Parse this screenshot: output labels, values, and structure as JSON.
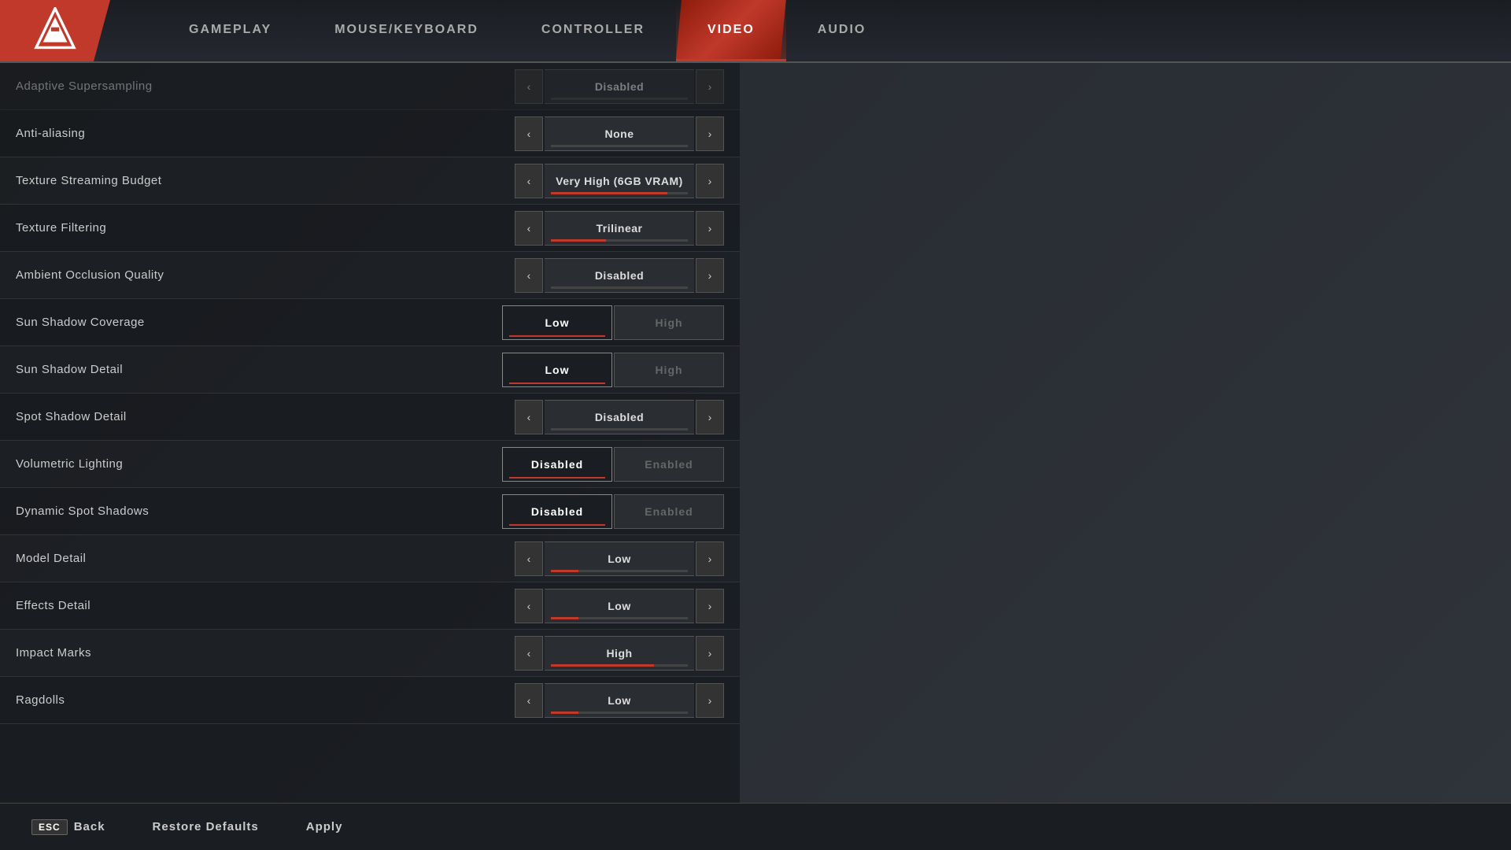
{
  "nav": {
    "tabs": [
      {
        "id": "gameplay",
        "label": "GAMEPLAY",
        "active": false
      },
      {
        "id": "mouse-keyboard",
        "label": "MOUSE/KEYBOARD",
        "active": false
      },
      {
        "id": "controller",
        "label": "CONTROLLER",
        "active": false
      },
      {
        "id": "video",
        "label": "VIDEO",
        "active": true
      },
      {
        "id": "audio",
        "label": "AUDIO",
        "active": false
      }
    ]
  },
  "settings": {
    "rows": [
      {
        "id": "adaptive-supersampling",
        "label": "Adaptive Supersampling",
        "type": "arrow",
        "value": "Disabled",
        "bar_pct": 0,
        "dimmed": true
      },
      {
        "id": "anti-aliasing",
        "label": "Anti-aliasing",
        "type": "arrow",
        "value": "None",
        "bar_pct": 0
      },
      {
        "id": "texture-streaming-budget",
        "label": "Texture Streaming Budget",
        "type": "arrow",
        "value": "Very High (6GB VRAM)",
        "bar_pct": 85
      },
      {
        "id": "texture-filtering",
        "label": "Texture Filtering",
        "type": "arrow",
        "value": "Trilinear",
        "bar_pct": 40
      },
      {
        "id": "ambient-occlusion-quality",
        "label": "Ambient Occlusion Quality",
        "type": "arrow",
        "value": "Disabled",
        "bar_pct": 0
      },
      {
        "id": "sun-shadow-coverage",
        "label": "Sun Shadow Coverage",
        "type": "toggle",
        "left": "Low",
        "right": "High",
        "selected": "left"
      },
      {
        "id": "sun-shadow-detail",
        "label": "Sun Shadow Detail",
        "type": "toggle",
        "left": "Low",
        "right": "High",
        "selected": "left"
      },
      {
        "id": "spot-shadow-detail",
        "label": "Spot Shadow Detail",
        "type": "arrow",
        "value": "Disabled",
        "bar_pct": 0
      },
      {
        "id": "volumetric-lighting",
        "label": "Volumetric Lighting",
        "type": "toggle",
        "left": "Disabled",
        "right": "Enabled",
        "selected": "left"
      },
      {
        "id": "dynamic-spot-shadows",
        "label": "Dynamic Spot Shadows",
        "type": "toggle",
        "left": "Disabled",
        "right": "Enabled",
        "selected": "left"
      },
      {
        "id": "model-detail",
        "label": "Model Detail",
        "type": "arrow",
        "value": "Low",
        "bar_pct": 20
      },
      {
        "id": "effects-detail",
        "label": "Effects Detail",
        "type": "arrow",
        "value": "Low",
        "bar_pct": 20
      },
      {
        "id": "impact-marks",
        "label": "Impact Marks",
        "type": "arrow",
        "value": "High",
        "bar_pct": 75
      },
      {
        "id": "ragdolls",
        "label": "Ragdolls",
        "type": "arrow",
        "value": "Low",
        "bar_pct": 20
      }
    ]
  },
  "bottom": {
    "back_key": "ESC",
    "back_label": "Back",
    "restore_label": "Restore Defaults",
    "apply_label": "Apply"
  }
}
